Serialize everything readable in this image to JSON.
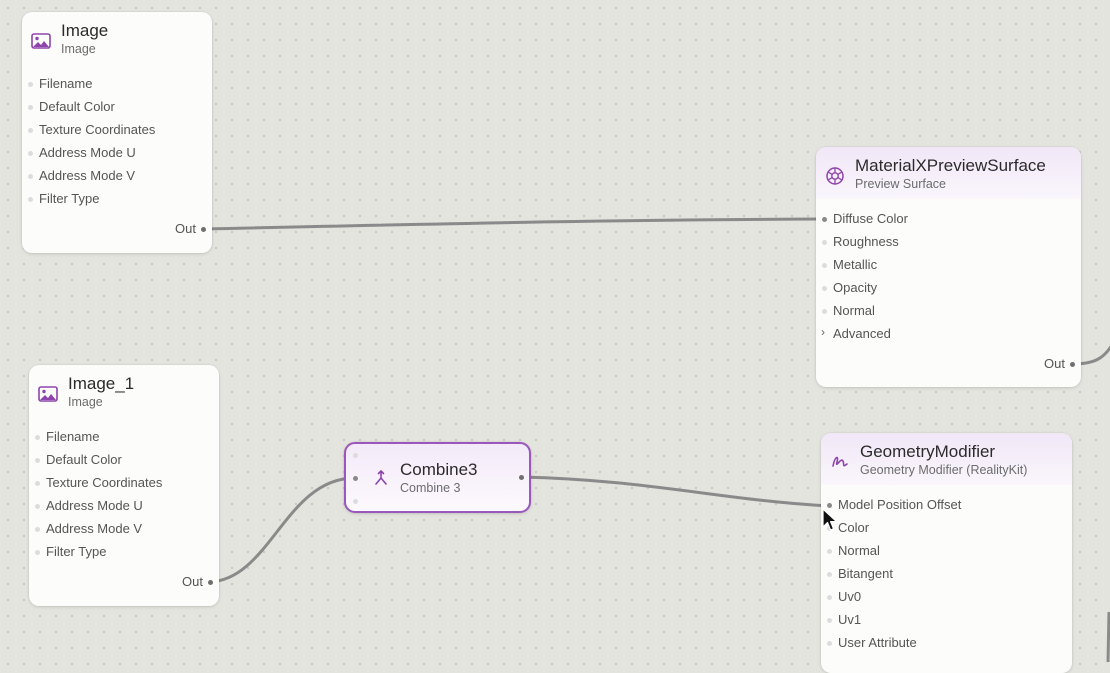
{
  "nodes": {
    "image": {
      "title": "Image",
      "subtitle": "Image",
      "inputs": [
        "Filename",
        "Default Color",
        "Texture Coordinates",
        "Address Mode U",
        "Address Mode V",
        "Filter Type"
      ],
      "output": "Out"
    },
    "image1": {
      "title": "Image_1",
      "subtitle": "Image",
      "inputs": [
        "Filename",
        "Default Color",
        "Texture Coordinates",
        "Address Mode U",
        "Address Mode V",
        "Filter Type"
      ],
      "output": "Out"
    },
    "preview": {
      "title": "MaterialXPreviewSurface",
      "subtitle": "Preview Surface",
      "inputs": [
        "Diffuse Color",
        "Roughness",
        "Metallic",
        "Opacity",
        "Normal"
      ],
      "advanced": "Advanced",
      "output": "Out"
    },
    "combine": {
      "title": "Combine3",
      "subtitle": "Combine 3"
    },
    "geometry": {
      "title": "GeometryModifier",
      "subtitle": "Geometry Modifier (RealityKit)",
      "inputs": [
        "Model Position Offset",
        "Color",
        "Normal",
        "Bitangent",
        "Uv0",
        "Uv1",
        "User Attribute"
      ]
    }
  },
  "colors": {
    "accent": "#9a58bc",
    "icon": "#8e44ad",
    "wire": "#8a8a8a"
  },
  "icons": {
    "image": "image-icon",
    "preview": "preview-surface-icon",
    "combine": "combine-icon",
    "geometry": "geometry-modifier-icon",
    "cursor": "mouse-pointer-icon"
  }
}
